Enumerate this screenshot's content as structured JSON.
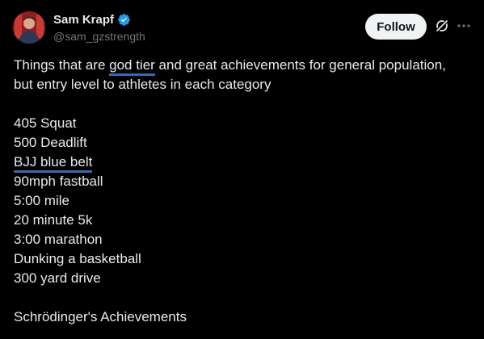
{
  "author": {
    "display_name": "Sam Krapf",
    "handle": "@sam_gzstrength",
    "verified": true
  },
  "actions": {
    "follow_label": "Follow",
    "grok_icon": "grok-icon",
    "more_icon": "more-icon"
  },
  "tweet": {
    "intro_1_before": "Things that are ",
    "intro_1_highlight": "god tier",
    "intro_1_after": " and great achievements for general population,",
    "intro_2": "but entry level to athletes in each category",
    "items": [
      "405 Squat",
      "500 Deadlift",
      "BJJ blue belt",
      "90mph fastball",
      "5:00 mile",
      "20 minute 5k",
      "3:00 marathon",
      "Dunking a basketball",
      "300 yard drive"
    ],
    "closing": "Schrödinger's Achievements"
  },
  "colors": {
    "background": "#000000",
    "text": "#e7e9ea",
    "secondary_text": "#71767b",
    "verified_blue": "#1d9bf0",
    "highlight_underline": "#1d6fd6",
    "follow_bg": "#eff3f4"
  }
}
